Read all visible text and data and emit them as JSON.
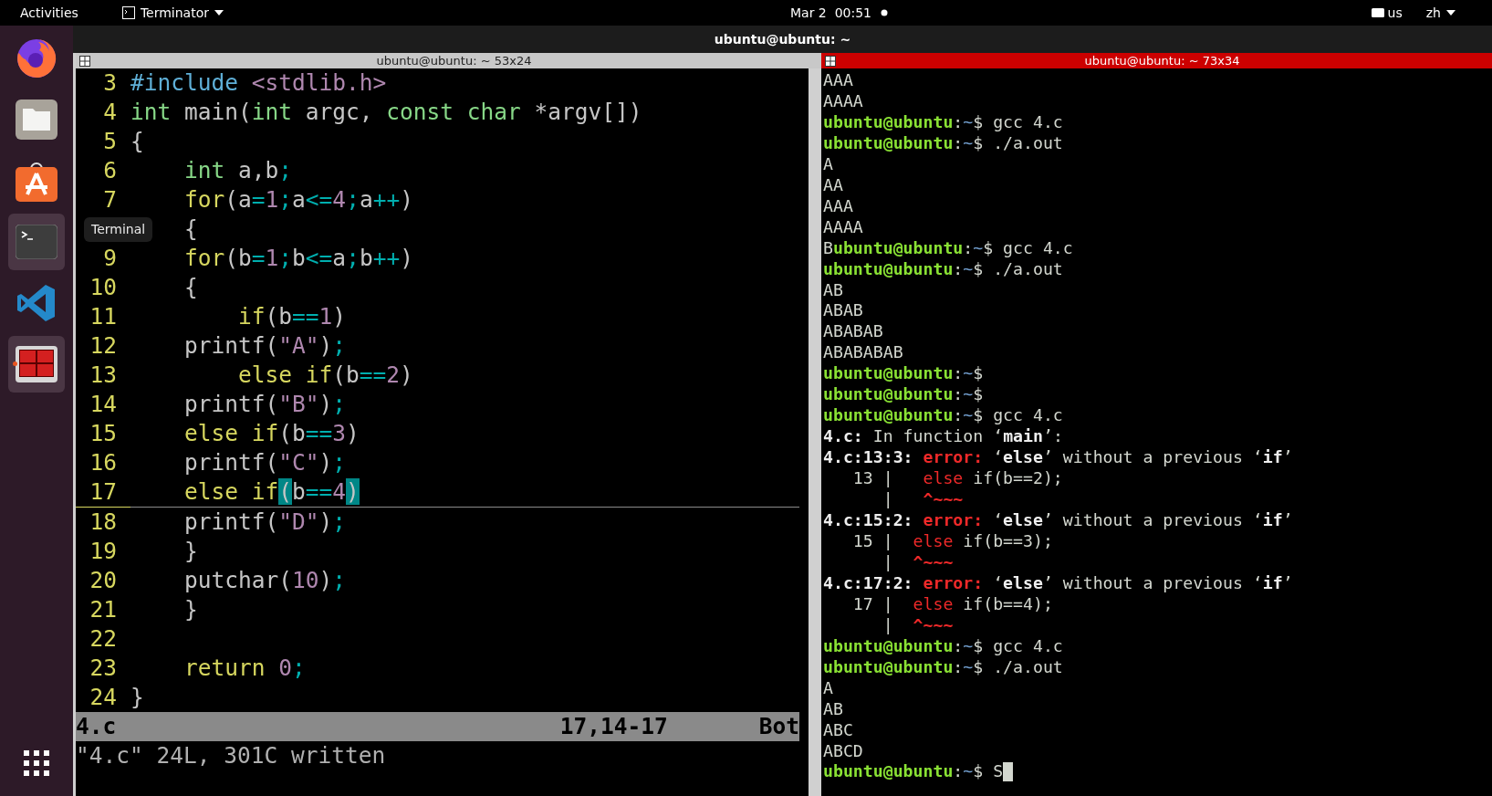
{
  "top_bar": {
    "activities": "Activities",
    "app": "Terminator",
    "clock": "Mar 2  00:51",
    "keyboard": "us",
    "language": "zh"
  },
  "dock": {
    "items": [
      {
        "kind": "browser",
        "highlighted": false,
        "running": false
      },
      {
        "kind": "files",
        "highlighted": false,
        "running": false
      },
      {
        "kind": "store",
        "highlighted": false,
        "running": false
      },
      {
        "kind": "terminal",
        "highlighted": true,
        "running": false
      },
      {
        "kind": "editor",
        "highlighted": false,
        "running": false
      },
      {
        "kind": "terminator",
        "highlighted": true,
        "running": true
      }
    ],
    "tooltip": "Terminal"
  },
  "window": {
    "title": "ubuntu@ubuntu: ~"
  },
  "panes": [
    {
      "title": "ubuntu@ubuntu: ~ 53x24",
      "focused": false
    },
    {
      "title": "ubuntu@ubuntu: ~ 73x34",
      "focused": true
    }
  ],
  "editor": {
    "lines": [
      {
        "number": "3",
        "cursor": false,
        "code": [
          {
            "t": "#include",
            "kind": "preproc"
          },
          {
            "t": " <stdlib.h>",
            "kind": "string"
          }
        ]
      },
      {
        "number": "4",
        "cursor": false,
        "code": [
          {
            "t": "int",
            "kind": "type"
          },
          {
            "t": " main(",
            "kind": "plain"
          },
          {
            "t": "int",
            "kind": "type"
          },
          {
            "t": " argc, ",
            "kind": "plain"
          },
          {
            "t": "const char",
            "kind": "type"
          },
          {
            "t": " *argv[])",
            "kind": "plain"
          }
        ]
      },
      {
        "number": "5",
        "cursor": false,
        "code": [
          {
            "t": "{",
            "kind": "plain"
          }
        ]
      },
      {
        "number": "6",
        "cursor": false,
        "code": [
          {
            "t": "    int",
            "kind": "type"
          },
          {
            "t": " a,b",
            "kind": "plain"
          },
          {
            "t": ";",
            "kind": "op"
          }
        ]
      },
      {
        "number": "7",
        "cursor": false,
        "code": [
          {
            "t": "    for",
            "kind": "keyword"
          },
          {
            "t": "(a",
            "kind": "plain"
          },
          {
            "t": "=",
            "kind": "op"
          },
          {
            "t": "1",
            "kind": "number"
          },
          {
            "t": ";",
            "kind": "op"
          },
          {
            "t": "a",
            "kind": "plain"
          },
          {
            "t": "<=",
            "kind": "op"
          },
          {
            "t": "4",
            "kind": "number"
          },
          {
            "t": ";",
            "kind": "op"
          },
          {
            "t": "a",
            "kind": "plain"
          },
          {
            "t": "++",
            "kind": "op"
          },
          {
            "t": ")",
            "kind": "plain"
          }
        ]
      },
      {
        "cursor": false,
        "code": [
          {
            "t": "    {",
            "kind": "plain"
          }
        ]
      },
      {
        "number": "9",
        "cursor": false,
        "code": [
          {
            "t": "    for",
            "kind": "keyword"
          },
          {
            "t": "(b",
            "kind": "plain"
          },
          {
            "t": "=",
            "kind": "op"
          },
          {
            "t": "1",
            "kind": "number"
          },
          {
            "t": ";",
            "kind": "op"
          },
          {
            "t": "b",
            "kind": "plain"
          },
          {
            "t": "<=",
            "kind": "op"
          },
          {
            "t": "a",
            "kind": "plain"
          },
          {
            "t": ";",
            "kind": "op"
          },
          {
            "t": "b",
            "kind": "plain"
          },
          {
            "t": "++",
            "kind": "op"
          },
          {
            "t": ")",
            "kind": "plain"
          }
        ]
      },
      {
        "number": "10",
        "cursor": false,
        "code": [
          {
            "t": "    {",
            "kind": "plain"
          }
        ]
      },
      {
        "number": "11",
        "cursor": false,
        "code": [
          {
            "t": "        if",
            "kind": "keyword"
          },
          {
            "t": "(b",
            "kind": "plain"
          },
          {
            "t": "==",
            "kind": "op"
          },
          {
            "t": "1",
            "kind": "number"
          },
          {
            "t": ")",
            "kind": "plain"
          }
        ]
      },
      {
        "number": "12",
        "cursor": false,
        "code": [
          {
            "t": "    printf(",
            "kind": "plain"
          },
          {
            "t": "\"A\"",
            "kind": "string"
          },
          {
            "t": ")",
            "kind": "plain"
          },
          {
            "t": ";",
            "kind": "op"
          }
        ]
      },
      {
        "number": "13",
        "cursor": false,
        "code": [
          {
            "t": "        else if",
            "kind": "keyword"
          },
          {
            "t": "(b",
            "kind": "plain"
          },
          {
            "t": "==",
            "kind": "op"
          },
          {
            "t": "2",
            "kind": "number"
          },
          {
            "t": ")",
            "kind": "plain"
          }
        ]
      },
      {
        "number": "14",
        "cursor": false,
        "code": [
          {
            "t": "    printf(",
            "kind": "plain"
          },
          {
            "t": "\"B\"",
            "kind": "string"
          },
          {
            "t": ")",
            "kind": "plain"
          },
          {
            "t": ";",
            "kind": "op"
          }
        ]
      },
      {
        "number": "15",
        "cursor": false,
        "code": [
          {
            "t": "    else if",
            "kind": "keyword"
          },
          {
            "t": "(b",
            "kind": "plain"
          },
          {
            "t": "==",
            "kind": "op"
          },
          {
            "t": "3",
            "kind": "number"
          },
          {
            "t": ")",
            "kind": "plain"
          }
        ]
      },
      {
        "number": "16",
        "cursor": false,
        "code": [
          {
            "t": "    printf(",
            "kind": "plain"
          },
          {
            "t": "\"C\"",
            "kind": "string"
          },
          {
            "t": ")",
            "kind": "plain"
          },
          {
            "t": ";",
            "kind": "op"
          }
        ]
      },
      {
        "number": "17",
        "cursor": true,
        "code": [
          {
            "t": "    else if",
            "kind": "keyword"
          },
          {
            "t": "(",
            "kind": "match"
          },
          {
            "t": "b",
            "kind": "plain"
          },
          {
            "t": "==",
            "kind": "op"
          },
          {
            "t": "4",
            "kind": "number"
          },
          {
            "t": ")",
            "kind": "match"
          }
        ]
      },
      {
        "number": "18",
        "cursor": false,
        "code": [
          {
            "t": "    printf(",
            "kind": "plain"
          },
          {
            "t": "\"D\"",
            "kind": "string"
          },
          {
            "t": ")",
            "kind": "plain"
          },
          {
            "t": ";",
            "kind": "op"
          }
        ]
      },
      {
        "number": "19",
        "cursor": false,
        "code": [
          {
            "t": "    }",
            "kind": "plain"
          }
        ]
      },
      {
        "number": "20",
        "cursor": false,
        "code": [
          {
            "t": "    putchar(",
            "kind": "plain"
          },
          {
            "t": "10",
            "kind": "number"
          },
          {
            "t": ")",
            "kind": "plain"
          },
          {
            "t": ";",
            "kind": "op"
          }
        ]
      },
      {
        "number": "21",
        "cursor": false,
        "code": [
          {
            "t": "    }",
            "kind": "plain"
          }
        ]
      },
      {
        "number": "22",
        "cursor": false
      },
      {
        "number": "23",
        "cursor": false,
        "code": [
          {
            "t": "    return",
            "kind": "keyword"
          },
          {
            "t": " 0",
            "kind": "number"
          },
          {
            "t": ";",
            "kind": "op"
          }
        ]
      },
      {
        "number": "24",
        "cursor": false,
        "code": [
          {
            "t": "}",
            "kind": "plain"
          }
        ]
      }
    ],
    "status": {
      "file": "4.c",
      "position": "17,14-17",
      "scroll": "Bot"
    },
    "message": "\"4.c\" 24L, 301C written"
  },
  "terminal": {
    "cursor": true,
    "lines": [
      [
        {
          "t": "AAA",
          "kind": "plain"
        }
      ],
      [
        {
          "t": "AAAA",
          "kind": "plain"
        }
      ],
      [
        {
          "t": "ubuntu@ubuntu",
          "kind": "user"
        },
        {
          "t": ":",
          "kind": "plain"
        },
        {
          "t": "~",
          "kind": "path"
        },
        {
          "t": "$ gcc 4.c",
          "kind": "plain"
        }
      ],
      [
        {
          "t": "ubuntu@ubuntu",
          "kind": "user"
        },
        {
          "t": ":",
          "kind": "plain"
        },
        {
          "t": "~",
          "kind": "path"
        },
        {
          "t": "$ ./a.out",
          "kind": "plain"
        }
      ],
      [
        {
          "t": "A",
          "kind": "plain"
        }
      ],
      [
        {
          "t": "AA",
          "kind": "plain"
        }
      ],
      [
        {
          "t": "AAA",
          "kind": "plain"
        }
      ],
      [
        {
          "t": "AAAA",
          "kind": "plain"
        }
      ],
      [
        {
          "t": "B",
          "kind": "plain"
        },
        {
          "t": "ubuntu@ubuntu",
          "kind": "user"
        },
        {
          "t": ":",
          "kind": "plain"
        },
        {
          "t": "~",
          "kind": "path"
        },
        {
          "t": "$ gcc 4.c",
          "kind": "plain"
        }
      ],
      [
        {
          "t": "ubuntu@ubuntu",
          "kind": "user"
        },
        {
          "t": ":",
          "kind": "plain"
        },
        {
          "t": "~",
          "kind": "path"
        },
        {
          "t": "$ ./a.out",
          "kind": "plain"
        }
      ],
      [
        {
          "t": "AB",
          "kind": "plain"
        }
      ],
      [
        {
          "t": "ABAB",
          "kind": "plain"
        }
      ],
      [
        {
          "t": "ABABAB",
          "kind": "plain"
        }
      ],
      [
        {
          "t": "ABABABAB",
          "kind": "plain"
        }
      ],
      [
        {
          "t": "ubuntu@ubuntu",
          "kind": "user"
        },
        {
          "t": ":",
          "kind": "plain"
        },
        {
          "t": "~",
          "kind": "path"
        },
        {
          "t": "$",
          "kind": "plain"
        }
      ],
      [
        {
          "t": "ubuntu@ubuntu",
          "kind": "user"
        },
        {
          "t": ":",
          "kind": "plain"
        },
        {
          "t": "~",
          "kind": "path"
        },
        {
          "t": "$",
          "kind": "plain"
        }
      ],
      [
        {
          "t": "ubuntu@ubuntu",
          "kind": "user"
        },
        {
          "t": ":",
          "kind": "plain"
        },
        {
          "t": "~",
          "kind": "path"
        },
        {
          "t": "$ gcc 4.c",
          "kind": "plain"
        }
      ],
      [
        {
          "t": "4.c:",
          "kind": "bold"
        },
        {
          "t": " In function ‘",
          "kind": "plain"
        },
        {
          "t": "main",
          "kind": "bold"
        },
        {
          "t": "’:",
          "kind": "plain"
        }
      ],
      [
        {
          "t": "4.c:13:3: ",
          "kind": "bold"
        },
        {
          "t": "error:",
          "kind": "error"
        },
        {
          "t": " ‘",
          "kind": "plain"
        },
        {
          "t": "else",
          "kind": "bold"
        },
        {
          "t": "’ without a previous ‘",
          "kind": "plain"
        },
        {
          "t": "if",
          "kind": "bold"
        },
        {
          "t": "’",
          "kind": "plain"
        }
      ],
      [
        {
          "t": "   13 |   ",
          "kind": "plain"
        },
        {
          "t": "else",
          "kind": "errtext"
        },
        {
          "t": " if(b==2);",
          "kind": "plain"
        }
      ],
      [
        {
          "t": "      |   ",
          "kind": "plain"
        },
        {
          "t": "^~~~",
          "kind": "error"
        }
      ],
      [
        {
          "t": "4.c:15:2: ",
          "kind": "bold"
        },
        {
          "t": "error:",
          "kind": "error"
        },
        {
          "t": " ‘",
          "kind": "plain"
        },
        {
          "t": "else",
          "kind": "bold"
        },
        {
          "t": "’ without a previous ‘",
          "kind": "plain"
        },
        {
          "t": "if",
          "kind": "bold"
        },
        {
          "t": "’",
          "kind": "plain"
        }
      ],
      [
        {
          "t": "   15 |  ",
          "kind": "plain"
        },
        {
          "t": "else",
          "kind": "errtext"
        },
        {
          "t": " if(b==3);",
          "kind": "plain"
        }
      ],
      [
        {
          "t": "      |  ",
          "kind": "plain"
        },
        {
          "t": "^~~~",
          "kind": "error"
        }
      ],
      [
        {
          "t": "4.c:17:2: ",
          "kind": "bold"
        },
        {
          "t": "error:",
          "kind": "error"
        },
        {
          "t": " ‘",
          "kind": "plain"
        },
        {
          "t": "else",
          "kind": "bold"
        },
        {
          "t": "’ without a previous ‘",
          "kind": "plain"
        },
        {
          "t": "if",
          "kind": "bold"
        },
        {
          "t": "’",
          "kind": "plain"
        }
      ],
      [
        {
          "t": "   17 |  ",
          "kind": "plain"
        },
        {
          "t": "else",
          "kind": "errtext"
        },
        {
          "t": " if(b==4);",
          "kind": "plain"
        }
      ],
      [
        {
          "t": "      |  ",
          "kind": "plain"
        },
        {
          "t": "^~~~",
          "kind": "error"
        }
      ],
      [
        {
          "t": "ubuntu@ubuntu",
          "kind": "user"
        },
        {
          "t": ":",
          "kind": "plain"
        },
        {
          "t": "~",
          "kind": "path"
        },
        {
          "t": "$ gcc 4.c",
          "kind": "plain"
        }
      ],
      [
        {
          "t": "ubuntu@ubuntu",
          "kind": "user"
        },
        {
          "t": ":",
          "kind": "plain"
        },
        {
          "t": "~",
          "kind": "path"
        },
        {
          "t": "$ ./a.out",
          "kind": "plain"
        }
      ],
      [
        {
          "t": "A",
          "kind": "plain"
        }
      ],
      [
        {
          "t": "AB",
          "kind": "plain"
        }
      ],
      [
        {
          "t": "ABC",
          "kind": "plain"
        }
      ],
      [
        {
          "t": "ABCD",
          "kind": "plain"
        }
      ],
      [
        {
          "t": "ubuntu@ubuntu",
          "kind": "user"
        },
        {
          "t": ":",
          "kind": "plain"
        },
        {
          "t": "~",
          "kind": "path"
        },
        {
          "t": "$ S",
          "kind": "plain"
        }
      ]
    ]
  }
}
